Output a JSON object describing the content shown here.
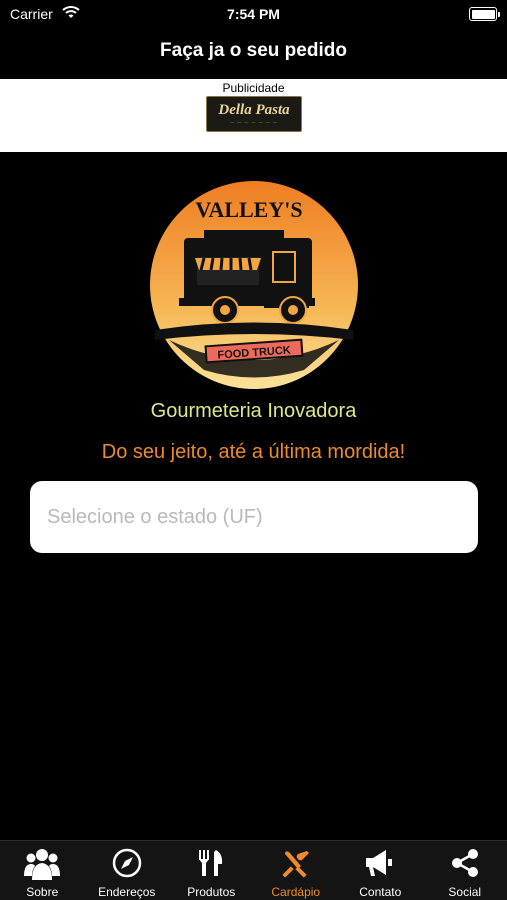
{
  "status_bar": {
    "carrier": "Carrier",
    "time": "7:54 PM"
  },
  "header": {
    "title": "Faça ja o seu pedido"
  },
  "ad": {
    "label": "Publicidade",
    "logo_text": "Della Pasta",
    "logo_icon": "della-pasta-logo"
  },
  "brand": {
    "logo_text_top": "VALLEY'S",
    "logo_text_banner": "FOOD TRUCK"
  },
  "taglines": {
    "line1": "Gourmeteria Inovadora",
    "line2": "Do seu jeito, até a última mordida!"
  },
  "state_select": {
    "placeholder": "Selecione o estado (UF)"
  },
  "colors": {
    "accent": "#ec8a2d",
    "tagline1": "#e0e788",
    "background": "#000000"
  },
  "tabs": [
    {
      "label": "Sobre",
      "icon": "people-icon",
      "active": false
    },
    {
      "label": "Endereços",
      "icon": "compass-icon",
      "active": false
    },
    {
      "label": "Produtos",
      "icon": "utensils-icon",
      "active": false
    },
    {
      "label": "Cardápio",
      "icon": "crossed-utensils-icon",
      "active": true
    },
    {
      "label": "Contato",
      "icon": "megaphone-icon",
      "active": false
    },
    {
      "label": "Social",
      "icon": "share-icon",
      "active": false
    }
  ]
}
